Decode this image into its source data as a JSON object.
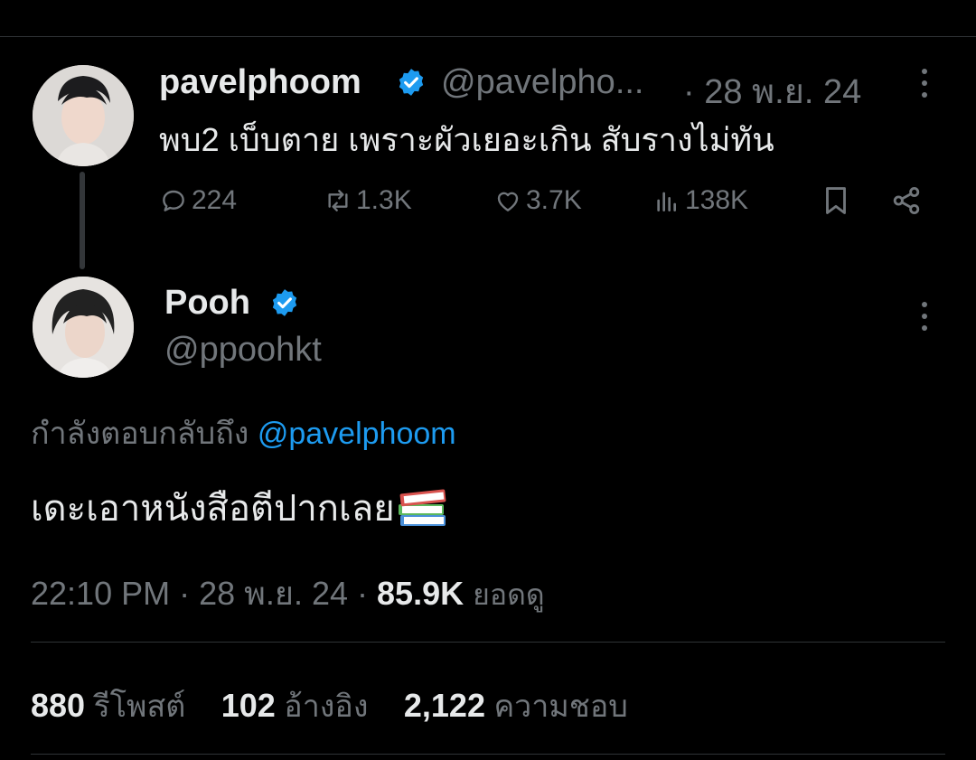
{
  "parent_tweet": {
    "name": "pavelphoom",
    "handle": "@pavelpho...",
    "date": "· 28 พ.ย. 24",
    "text": "พบ2 เบ็บตาย เพราะผัวเยอะเกิน สับรางไม่ทัน",
    "actions": {
      "replies": "224",
      "retweets": "1.3K",
      "likes": "3.7K",
      "views": "138K"
    }
  },
  "main_tweet": {
    "name": "Pooh",
    "handle": "@ppoohkt",
    "replying_prefix": "กำลังตอบกลับถึง",
    "replying_mention": "@pavelphoom",
    "text": "เดะเอาหนังสือตีปากเลย",
    "time": "22:10 PM",
    "date": "· 28 พ.ย. 24 ·",
    "views_count": "85.9K",
    "views_label": "ยอดดู",
    "stats": {
      "reposts_count": "880",
      "reposts_label": "รีโพสต์",
      "quotes_count": "102",
      "quotes_label": "อ้างอิง",
      "likes_count": "2,122",
      "likes_label": "ความชอบ"
    }
  },
  "colors": {
    "background": "#000000",
    "text": "#e7e9ea",
    "muted": "#71767b",
    "accent": "#1d9bf0",
    "divider": "#2f3336"
  },
  "icons": [
    "reply-icon",
    "retweet-icon",
    "like-icon",
    "views-icon",
    "bookmark-icon",
    "share-icon",
    "verified-icon",
    "more-icon",
    "books-emoji-icon"
  ]
}
